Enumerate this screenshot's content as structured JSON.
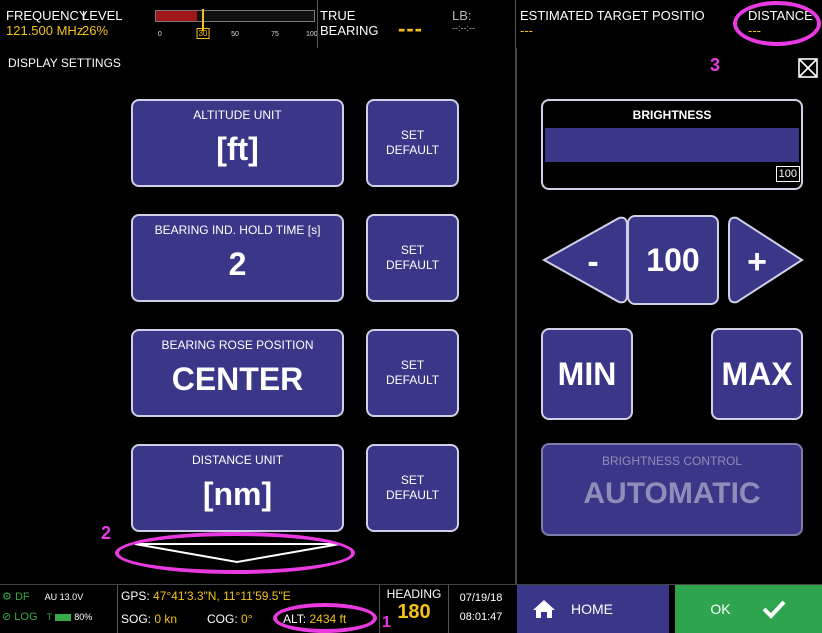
{
  "topbar": {
    "frequency_label": "FREQUENCY",
    "frequency_value": "121.500 MHz",
    "level_label": "LEVEL",
    "level_value": "26%",
    "level_fraction": 0.26,
    "level_ticks": [
      "0",
      "30",
      "50",
      "75",
      "100"
    ],
    "level_selected_tick": "30",
    "true_label": "TRUE",
    "bearing_label": "BEARING",
    "bearing_value": "---",
    "lb_label": "LB:",
    "lb_value": "--:--:--",
    "est_label": "ESTIMATED TARGET POSITIO",
    "est_value": "---",
    "distance_label": "DISTANCE",
    "distance_value": "---"
  },
  "left_panel": {
    "title": "DISPLAY SETTINGS",
    "settings": [
      {
        "label": "ALTITUDE UNIT",
        "value": "[ft]",
        "default_label": "SET DEFAULT"
      },
      {
        "label": "BEARING IND. HOLD TIME [s]",
        "value": "2",
        "default_label": "SET DEFAULT"
      },
      {
        "label": "BEARING ROSE POSITION",
        "value": "CENTER",
        "default_label": "SET DEFAULT"
      },
      {
        "label": "DISTANCE UNIT",
        "value": "[nm]",
        "default_label": "SET DEFAULT"
      }
    ]
  },
  "right_panel": {
    "brightness_title": "BRIGHTNESS",
    "brightness_value": "100",
    "brightness_fraction": 1.0,
    "minus_label": "-",
    "plus_label": "+",
    "current_value": "100",
    "min_label": "MIN",
    "max_label": "MAX",
    "control_label": "BRIGHTNESS CONTROL",
    "control_value": "AUTOMATIC"
  },
  "annotations": {
    "n1": "1",
    "n2": "2",
    "n3": "3"
  },
  "bottombar": {
    "df_label": "DF",
    "voltage": "AU 13.0V",
    "log_label": "LOG",
    "battery": "T",
    "battery_pct": "80%",
    "gps_label": "GPS:",
    "gps_value": "47°41'3.3\"N, 11°11'59.5\"E",
    "sog_label": "SOG:",
    "sog_value": "0 kn",
    "cog_label": "COG:",
    "cog_value": "0°",
    "alt_label": "ALT:",
    "alt_value": "2434 ft",
    "heading_label": "HEADING",
    "heading_value": "180",
    "date": "07/19/18",
    "time": "08:01:47",
    "home_label": "HOME",
    "ok_label": "OK"
  },
  "colors": {
    "accent": "#3a3688",
    "value_yellow": "#f2c21a",
    "level_red": "#a01515",
    "ok_green": "#2ea44f",
    "annotation_magenta": "#e83ae0"
  }
}
